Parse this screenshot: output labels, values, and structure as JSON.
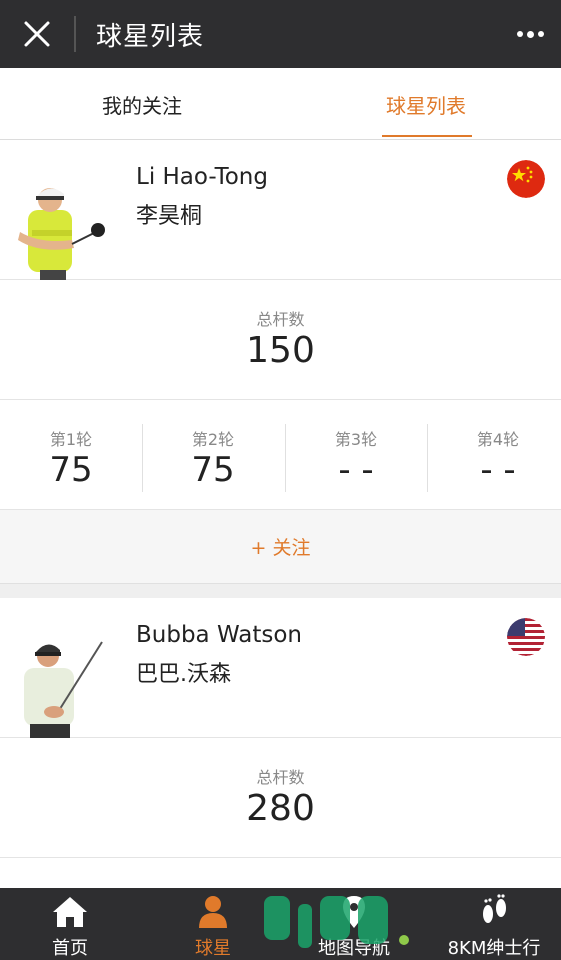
{
  "topbar": {
    "title": "球星列表",
    "close_icon": "close-icon",
    "more_icon": "more-dots-icon"
  },
  "tabs": [
    {
      "label": "我的关注",
      "active": false
    },
    {
      "label": "球星列表",
      "active": true
    }
  ],
  "players": [
    {
      "name_en": "Li Hao-Tong",
      "name_cn": "李昊桐",
      "country_flag": "china-flag-icon",
      "total_label": "总杆数",
      "total": "150",
      "rounds": [
        {
          "label": "第1轮",
          "value": "75"
        },
        {
          "label": "第2轮",
          "value": "75"
        },
        {
          "label": "第3轮",
          "value": "- -"
        },
        {
          "label": "第4轮",
          "value": "- -"
        }
      ],
      "follow_label": "+ 关注"
    },
    {
      "name_en": "Bubba Watson",
      "name_cn": "巴巴.沃森",
      "country_flag": "usa-flag-icon",
      "total_label": "总杆数",
      "total": "280"
    }
  ],
  "bottom_nav": [
    {
      "label": "首页",
      "icon": "home-icon",
      "active": false
    },
    {
      "label": "球星",
      "icon": "person-icon",
      "active": true
    },
    {
      "label": "地图导航",
      "icon": "map-pin-icon",
      "active": false
    },
    {
      "label": "8KM绅士行",
      "icon": "footprints-icon",
      "active": false
    }
  ],
  "colors": {
    "accent": "#e07a2b",
    "bar": "#2e2e30",
    "watermark_green": "#1aa36a"
  }
}
